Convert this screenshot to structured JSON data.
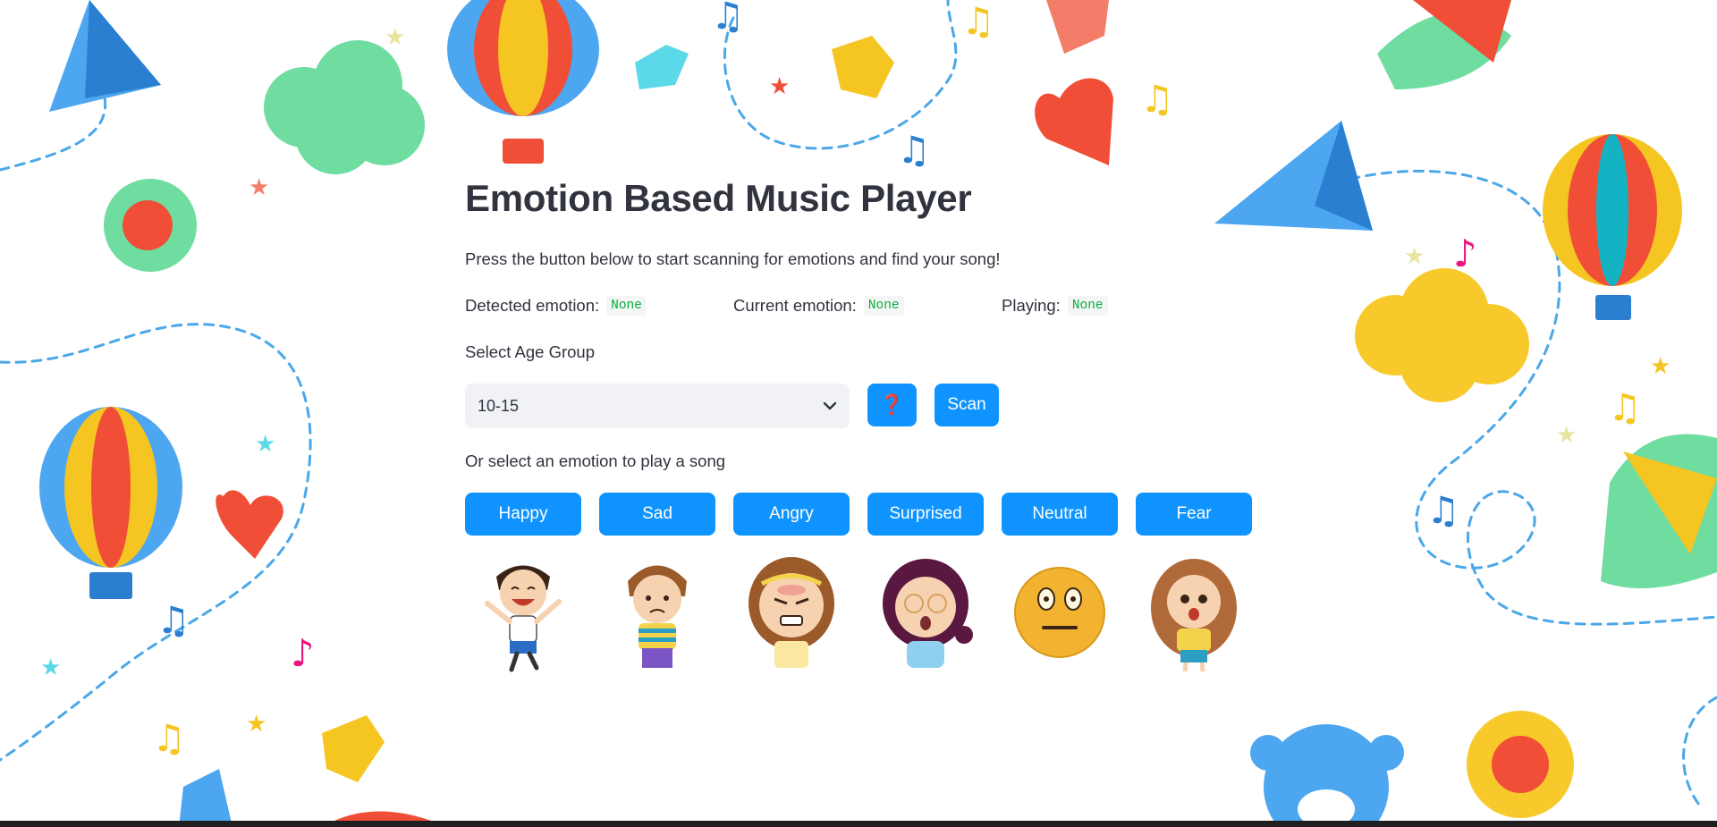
{
  "app": {
    "title": "Emotion Based Music Player",
    "intro": "Press the button below to start scanning for emotions and find your song!"
  },
  "status": {
    "detected_label": "Detected emotion:",
    "detected_value": "None",
    "current_label": "Current emotion:",
    "current_value": "None",
    "playing_label": "Playing:",
    "playing_value": "None"
  },
  "age_group": {
    "label": "Select Age Group",
    "selected": "10-15"
  },
  "actions": {
    "help_icon": "question-mark-icon",
    "help_label": "❓",
    "scan_label": "Scan"
  },
  "emotions": {
    "prompt": "Or select an emotion to play a song",
    "buttons": [
      "Happy",
      "Sad",
      "Angry",
      "Surprised",
      "Neutral",
      "Fear"
    ]
  },
  "colors": {
    "accent": "#0f94ff",
    "code_green": "#09ab3b",
    "select_bg": "#f0f2f6",
    "text": "#31333f"
  }
}
